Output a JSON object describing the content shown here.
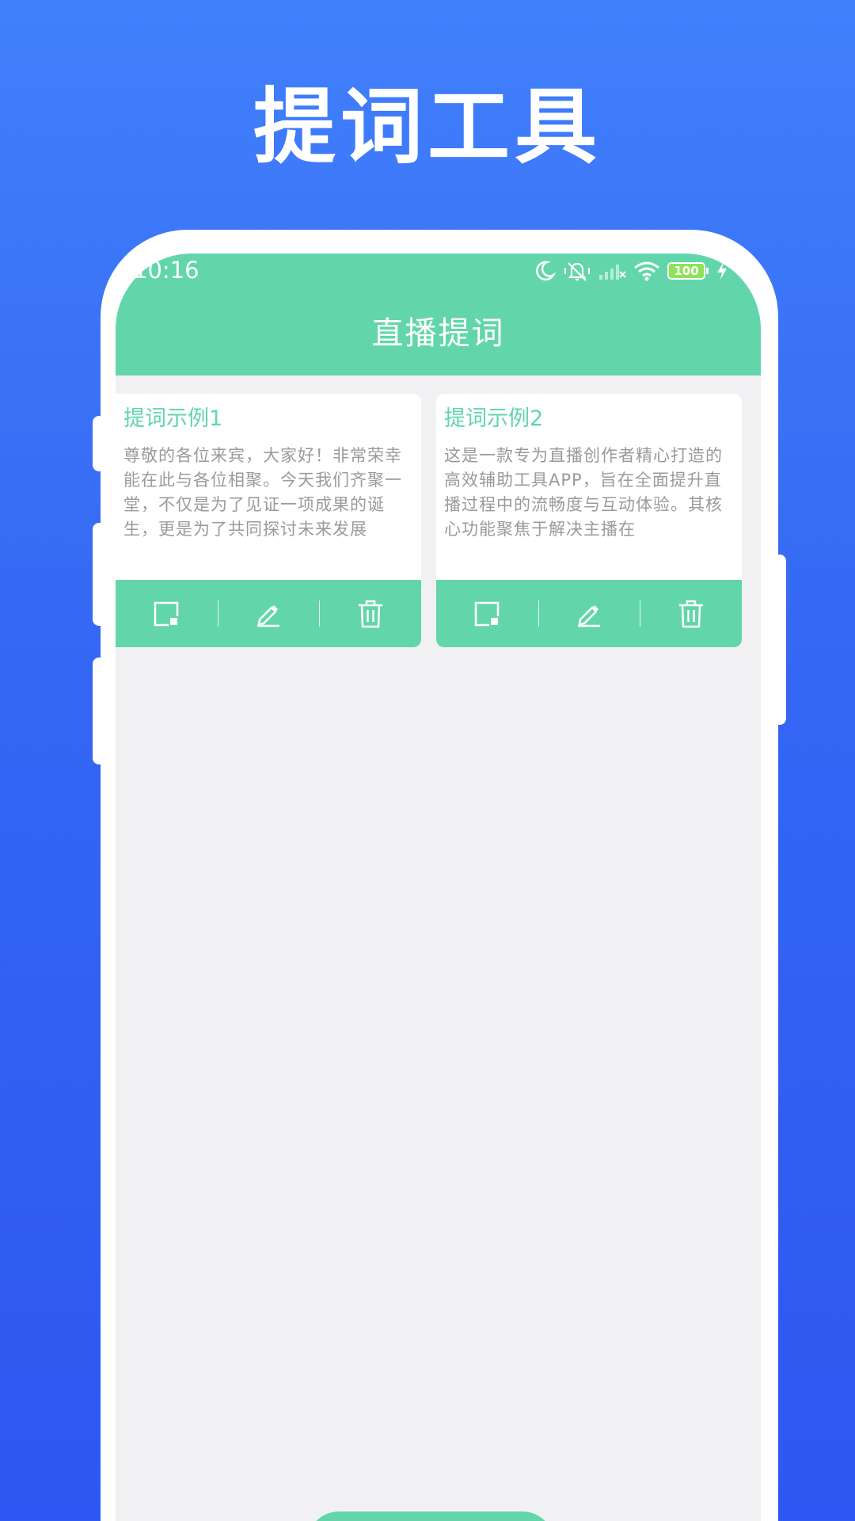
{
  "promo": {
    "title": "提词工具"
  },
  "status_bar": {
    "time": "10:16",
    "battery": "100",
    "icons": [
      "moon-icon",
      "muted-bell-icon",
      "signal-icon",
      "wifi-icon",
      "battery-icon",
      "charging-icon"
    ]
  },
  "app": {
    "title": "直播提词"
  },
  "cards": [
    {
      "title": "提词示例1",
      "text": "尊敬的各位来宾，大家好！非常荣幸能在此与各位相聚。今天我们齐聚一堂，不仅是为了见证一项成果的诞生，更是为了共同探讨未来发展",
      "actions": [
        "open-icon",
        "edit-icon",
        "delete-icon"
      ]
    },
    {
      "title": "提词示例2",
      "text": "这是一款专为直播创作者精心打造的高效辅助工具APP，旨在全面提升直播过程中的流畅度与互动体验。其核心功能聚焦于解决主播在",
      "actions": [
        "open-icon",
        "edit-icon",
        "delete-icon"
      ]
    }
  ],
  "colors": {
    "background_top": "#4180fb",
    "background_bottom": "#2d57f2",
    "accent": "#62d6aa",
    "screen_bg": "#f1f1f3",
    "body_text": "#9a9a9a"
  }
}
